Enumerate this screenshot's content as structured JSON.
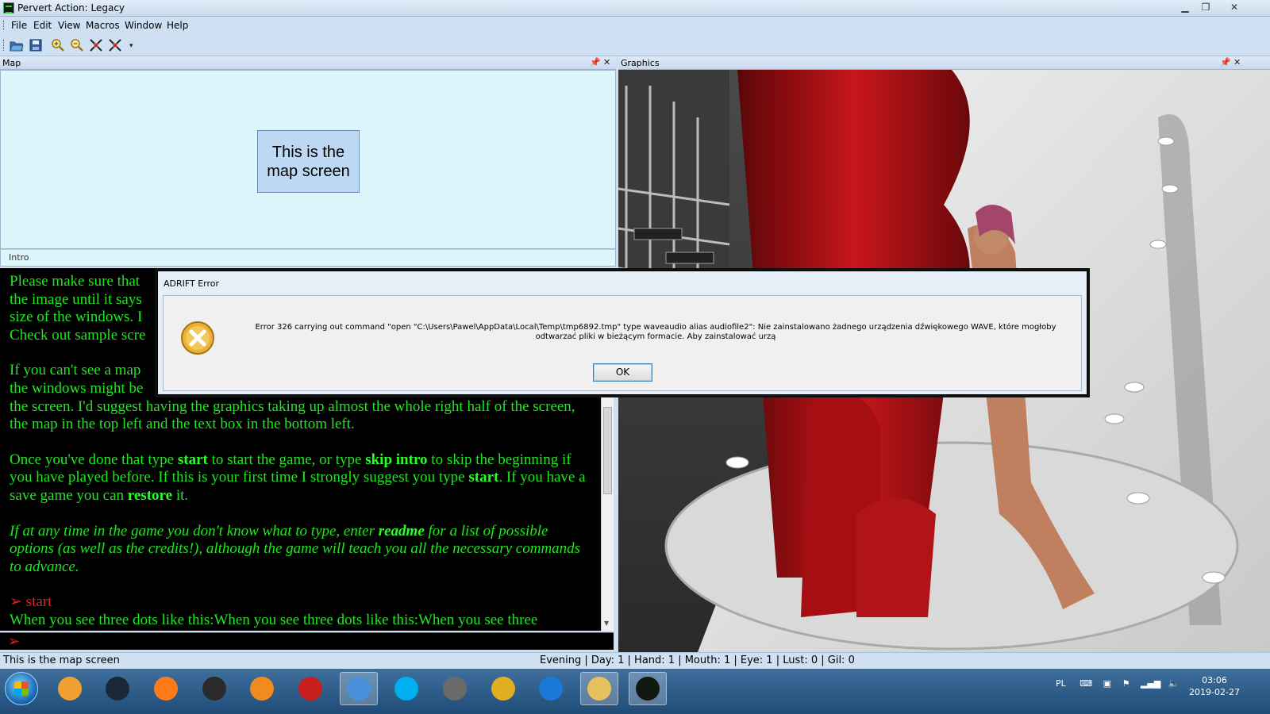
{
  "window": {
    "title": "Pervert Action: Legacy",
    "controls": [
      "minimize",
      "restore",
      "close"
    ]
  },
  "menu": [
    "File",
    "Edit",
    "View",
    "Macros",
    "Window",
    "Help"
  ],
  "toolbar": {
    "icons": [
      "open-folder-icon",
      "save-icon",
      "zoom-in-icon",
      "zoom-out-icon",
      "zoom-fit-icon",
      "zoom-reset-icon"
    ],
    "overflow_label": "▾"
  },
  "map_panel": {
    "title": "Map",
    "room_label": "This is the map screen",
    "footer_label": "Intro"
  },
  "graphics_panel": {
    "title": "Graphics"
  },
  "text_panel": {
    "para1": "Please make sure that the image until it says size of the windows. I Check out sample scre",
    "para2_a": "If you can't see a map",
    "para2_b": "the windows might be",
    "para2_c": "the screen. I'd suggest having the graphics taking up almost the whole right half of the screen, the map in the top left and the text box in the bottom left.",
    "para3_pre": "Once you've done that type ",
    "para3_b1": "start",
    "para3_mid1": " to start the game, or type ",
    "para3_b2": "skip intro",
    "para3_mid2": " to skip the beginning if you have played before. If this is your first time I strongly suggest you type ",
    "para3_b3": "start",
    "para3_mid3": ". If you have a save game you can ",
    "para3_b4": "restore",
    "para3_post": " it.",
    "para4_pre": "If at any time in the game you don't know what to type, enter ",
    "para4_b": "readme",
    "para4_post": " for a list of possible options (as well as the credits!), although the game will teach you all the necessary commands to advance.",
    "command": "start",
    "last_line": "When you see three dots like this:When you see three dots like this:When you see three"
  },
  "dialog": {
    "title": "ADRIFT Error",
    "message": "Error 326 carrying out command \"open \"C:\\Users\\Pawel\\AppData\\Local\\Temp\\tmp6892.tmp\" type waveaudio alias audiofile2\": Nie zainstalowano żadnego urządzenia dźwiękowego WAVE, które mogłoby odtwarzać pliki w bieżącym formacie. Aby zainstalować urzą",
    "ok_label": "OK"
  },
  "status": {
    "left": "This is the map screen",
    "right": "Evening | Day: 1 | Hand: 1 | Mouth: 1 | Eye: 1 | Lust: 0 | Gil: 0"
  },
  "taskbar": {
    "apps": [
      {
        "name": "puzzle-app-icon",
        "color": "#f0a030"
      },
      {
        "name": "steam-icon",
        "color": "#1b2838"
      },
      {
        "name": "firefox-icon",
        "color": "#ff7b1a"
      },
      {
        "name": "headset-icon",
        "color": "#2a2a2a"
      },
      {
        "name": "media-player-icon",
        "color": "#f38a1e"
      },
      {
        "name": "red-shield-icon",
        "color": "#c81e1e"
      },
      {
        "name": "chrome-profile-icon",
        "color": "#4a8fd9"
      },
      {
        "name": "skype-icon",
        "color": "#00aff0"
      },
      {
        "name": "coin-shield-icon",
        "color": "#6a6a6a"
      },
      {
        "name": "chrome-icon",
        "color": "#e0b020"
      },
      {
        "name": "ccleaner-icon",
        "color": "#1a7ad8"
      },
      {
        "name": "file-explorer-icon",
        "color": "#e8c060"
      },
      {
        "name": "adrift-runner-icon",
        "color": "#101810"
      }
    ],
    "language": "PL",
    "time": "03:06",
    "date": "2019-02-27"
  },
  "colors": {
    "text_green": "#1ee81e",
    "prompt_red": "#e02020",
    "map_bg": "#dcf6fc",
    "room_fill": "#bcd8f3"
  }
}
